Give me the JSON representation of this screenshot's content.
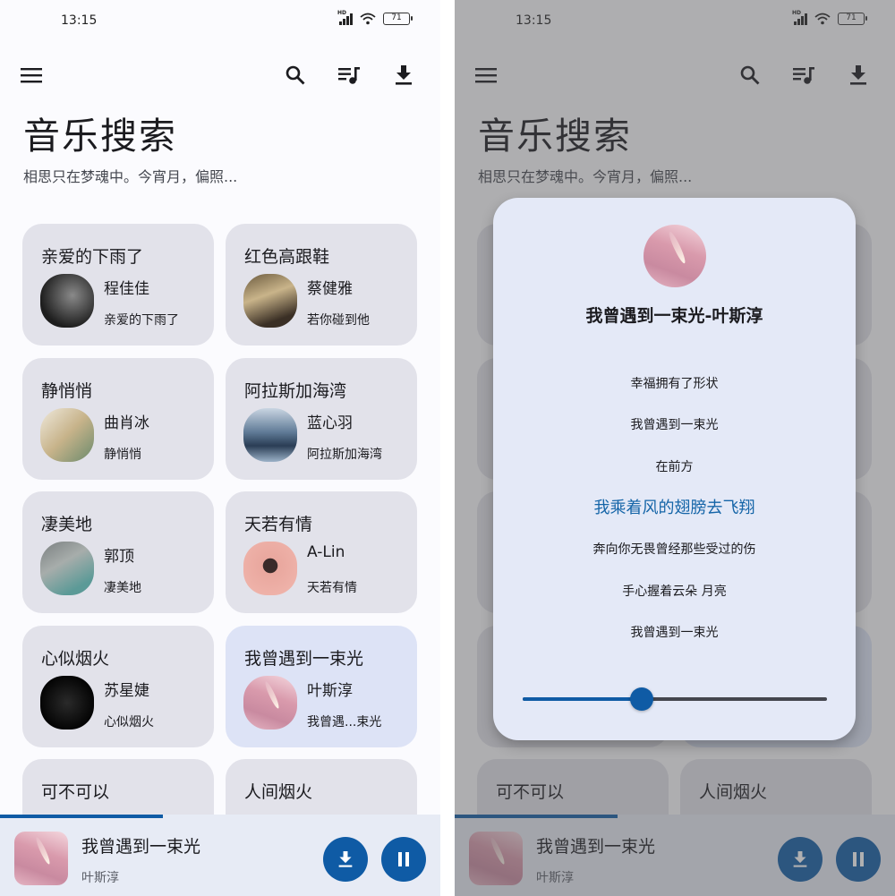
{
  "status_bar": {
    "time": "13:15",
    "network": "HD",
    "battery": "71"
  },
  "app_bar": {
    "menu_icon": "menu-icon",
    "search_icon": "search-icon",
    "queue_icon": "queue-music-icon",
    "download_icon": "download-icon"
  },
  "header": {
    "title": "音乐搜索",
    "subtitle": "相思只在梦魂中。今宵月，偏照..."
  },
  "songs": [
    {
      "title": "亲爱的下雨了",
      "artist": "程佳佳",
      "album": "亲爱的下雨了",
      "active": false
    },
    {
      "title": "红色高跟鞋",
      "artist": "蔡健雅",
      "album": "若你碰到他",
      "active": false
    },
    {
      "title": "静悄悄",
      "artist": "曲肖冰",
      "album": "静悄悄",
      "active": false
    },
    {
      "title": "阿拉斯加海湾",
      "artist": "蓝心羽",
      "album": "阿拉斯加海湾",
      "active": false
    },
    {
      "title": "凄美地",
      "artist": "郭顶",
      "album": "凄美地",
      "active": false
    },
    {
      "title": "天若有情",
      "artist": "A-Lin",
      "album": "天若有情",
      "active": false
    },
    {
      "title": "心似烟火",
      "artist": "苏星婕",
      "album": "心似烟火",
      "active": false
    },
    {
      "title": "我曾遇到一束光",
      "artist": "叶斯淳",
      "album": "我曾遇...束光",
      "active": true
    },
    {
      "title": "可不可以",
      "artist": "",
      "album": "",
      "active": false
    },
    {
      "title": "人间烟火",
      "artist": "",
      "album": "",
      "active": false
    }
  ],
  "mini_player": {
    "title": "我曾遇到一束光",
    "artist": "叶斯淳",
    "progress_percent": 37,
    "download_icon": "download-icon",
    "pause_icon": "pause-icon"
  },
  "lyrics_dialog": {
    "title": "我曾遇到一束光-叶斯淳",
    "lines": [
      "幸福拥有了形状",
      "我曾遇到一束光",
      "在前方",
      "我乘着风的翅膀去飞翔",
      "奔向你无畏曾经那些受过的伤",
      "手心握着云朵 月亮",
      "我曾遇到一束光"
    ],
    "current_line_index": 3,
    "seek_percent": 39
  },
  "colors": {
    "accent": "#0f5ba5",
    "current_lyric": "#1565a8",
    "card_bg": "#e2e2ea",
    "card_active_bg": "#dde3f6"
  }
}
